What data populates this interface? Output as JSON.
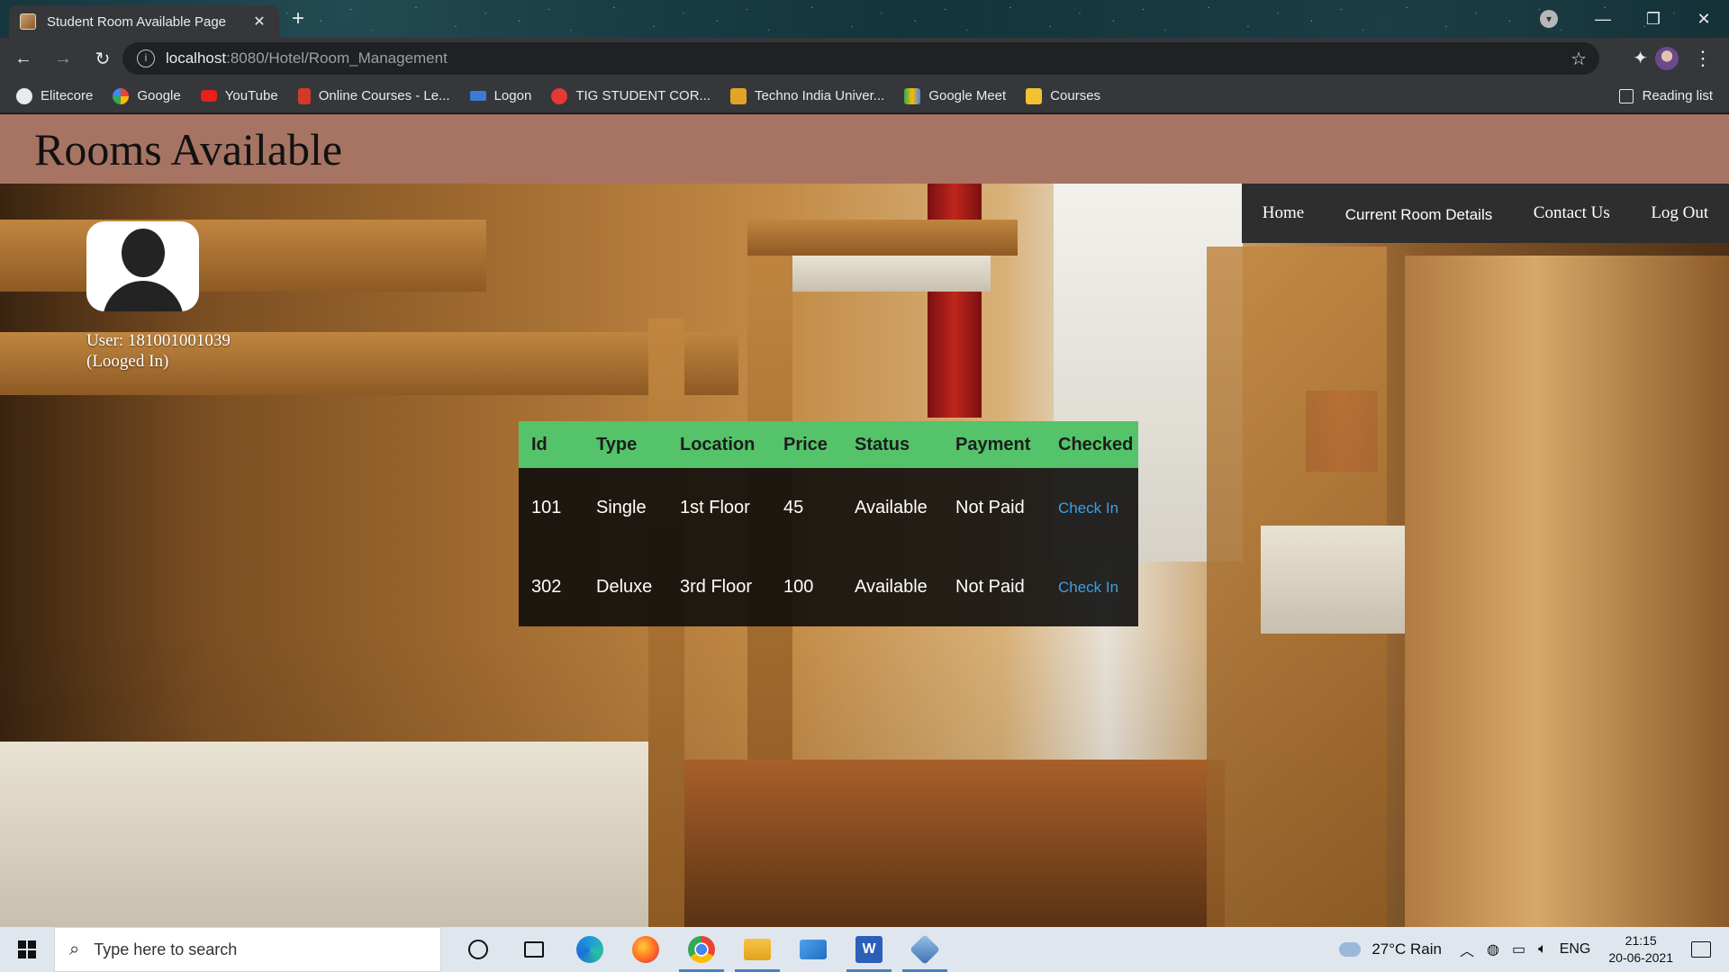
{
  "browser": {
    "tab_title": "Student Room Available Page",
    "tab_close": "✕",
    "new_tab": "+",
    "address_host": "localhost",
    "address_path": ":8080/Hotel/Room_Management",
    "bookmarks": [
      {
        "label": "Elitecore",
        "color": "#e8eaed"
      },
      {
        "label": "Google",
        "color": "#ffffff"
      },
      {
        "label": "YouTube",
        "color": "#e62117"
      },
      {
        "label": "Online Courses - Le...",
        "color": "#d23a2a"
      },
      {
        "label": "Logon",
        "color": "#3b7bd8"
      },
      {
        "label": "TIG STUDENT COR...",
        "color": "#e53935"
      },
      {
        "label": "Techno India Univer...",
        "color": "#e2a426"
      },
      {
        "label": "Google Meet",
        "color": "#34a853"
      },
      {
        "label": "Courses",
        "color": "#f2c230"
      }
    ],
    "reading_list": "Reading list"
  },
  "page": {
    "title": "Rooms Available",
    "nav": {
      "home": "Home",
      "current_room": "Current Room Details",
      "contact": "Contact Us",
      "logout": "Log Out"
    },
    "user": {
      "line1": "User: 181001001039",
      "line2": "(Looged In)"
    },
    "table": {
      "headers": [
        "Id",
        "Type",
        "Location",
        "Price",
        "Status",
        "Payment",
        "Checked"
      ],
      "rows": [
        {
          "id": "101",
          "type": "Single",
          "location": "1st Floor",
          "price": "45",
          "status": "Available",
          "payment": "Not Paid",
          "action": "Check In"
        },
        {
          "id": "302",
          "type": "Deluxe",
          "location": "3rd Floor",
          "price": "100",
          "status": "Available",
          "payment": "Not Paid",
          "action": "Check In"
        }
      ]
    }
  },
  "taskbar": {
    "search_placeholder": "Type here to search",
    "weather": "27°C  Rain",
    "language": "ENG",
    "time": "21:15",
    "date": "20-06-2021"
  },
  "colors": {
    "header_bg": "#a77464",
    "table_header_bg": "#54c36a",
    "link": "#3aa0e6",
    "navbar_bg": "#2e2e2e"
  }
}
